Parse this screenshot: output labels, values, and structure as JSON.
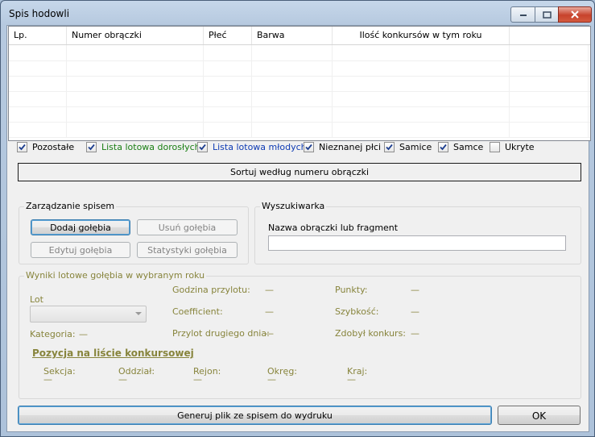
{
  "window": {
    "title": "Spis hodowli"
  },
  "grid": {
    "columns": [
      "Lp.",
      "Numer obrączki",
      "Płeć",
      "Barwa",
      "Ilość konkursów w tym roku",
      ""
    ]
  },
  "filters": [
    {
      "label": "Pozostałe",
      "checked": true,
      "color": "#000000"
    },
    {
      "label": "Lista lotowa dorosłych",
      "checked": true,
      "color": "#1a7f14"
    },
    {
      "label": "Lista lotowa młodych",
      "checked": true,
      "color": "#0e3bb4"
    },
    {
      "label": "Nieznanej płci",
      "checked": true,
      "color": "#000000"
    },
    {
      "label": "Samice",
      "checked": true,
      "color": "#000000"
    },
    {
      "label": "Samce",
      "checked": true,
      "color": "#000000"
    },
    {
      "label": "Ukryte",
      "checked": false,
      "color": "#000000"
    }
  ],
  "sort_button": "Sortuj według numeru obrączki",
  "manage": {
    "title": "Zarządzanie spisem",
    "add": "Dodaj gołębia",
    "remove": "Usuń gołębia",
    "edit": "Edytuj gołębia",
    "stats": "Statystyki gołębia"
  },
  "search": {
    "title": "Wyszukiwarka",
    "label": "Nazwa obrączki lub fragment",
    "value": ""
  },
  "results": {
    "title": "Wyniki lotowe gołębia w wybranym roku",
    "lot_label": "Lot",
    "lot_value": "",
    "godzina_label": "Godzina przylotu:",
    "godzina_value": "—",
    "punkty_label": "Punkty:",
    "punkty_value": "—",
    "coef_label": "Coefficient:",
    "coef_value": "—",
    "szybkosc_label": "Szybkość:",
    "szybkosc_value": "—",
    "kategoria_label": "Kategoria:",
    "kategoria_value": "—",
    "drugi_label": "Przylot drugiego dnia:",
    "drugi_value": "—",
    "konkurs_label": "Zdobył konkurs:",
    "konkurs_value": "—",
    "pozycja_title": "Pozycja na liście konkursowej",
    "sekcja_label": "Sekcja:",
    "sekcja_value": "—",
    "oddzial_label": "Oddział:",
    "oddzial_value": "—",
    "rejon_label": "Rejon:",
    "rejon_value": "—",
    "okreg_label": "Okręg:",
    "okreg_value": "—",
    "kraj_label": "Kraj:",
    "kraj_value": "—"
  },
  "footer": {
    "generate": "Generuj plik ze spisem do wydruku",
    "ok": "OK"
  }
}
